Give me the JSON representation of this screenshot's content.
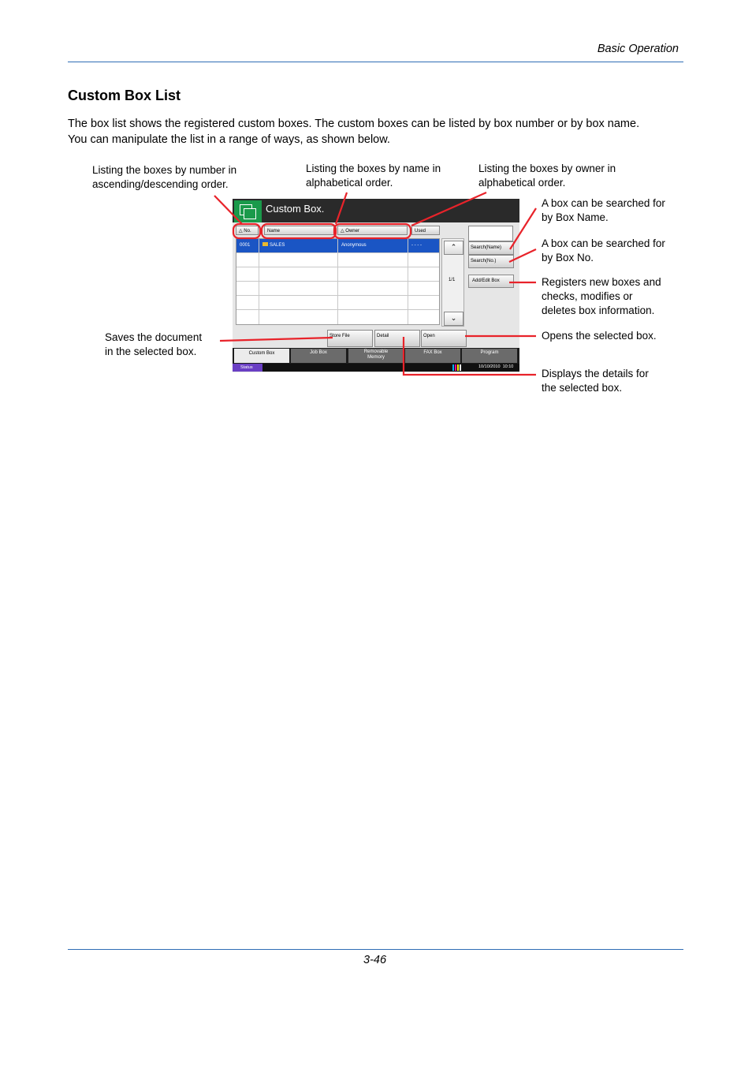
{
  "header": {
    "section_name": "Basic Operation",
    "page_number": "3-46"
  },
  "title": "Custom Box List",
  "intro": [
    "The box list shows the registered custom boxes. The custom boxes can be listed by box number or by box name.",
    "You can manipulate the list in a range of ways, as shown below."
  ],
  "callouts": {
    "sort_number": [
      "Listing the boxes by number in",
      "ascending/descending order."
    ],
    "sort_name": [
      "Listing the boxes by name in",
      "alphabetical order."
    ],
    "sort_owner": [
      "Listing the boxes by owner in",
      "alphabetical order."
    ],
    "search_name": [
      "A box can be searched for",
      "by Box Name."
    ],
    "search_no": [
      "A box can be searched for",
      "by Box No."
    ],
    "add_edit": [
      "Registers new boxes and",
      "checks, modifies or",
      "deletes box information."
    ],
    "store_file": [
      "Saves the document",
      "in the selected box."
    ],
    "open": [
      "Opens the selected box."
    ],
    "detail": [
      "Displays the details for",
      "the selected box."
    ]
  },
  "screen": {
    "title": "Custom Box.",
    "columns": {
      "no": "No.",
      "name": "Name",
      "owner": "Owner",
      "used": "Used"
    },
    "row": {
      "no": "0001",
      "name": "SALES",
      "owner": "Anonymous",
      "used": "- - - -"
    },
    "page_indicator": "1/1",
    "buttons": {
      "search_name": "Search(Name)",
      "search_no": "Search(No.)",
      "add_edit": "Add/Edit Box",
      "store_file": "Store File",
      "detail": "Detail",
      "open": "Open"
    },
    "tabs": {
      "custom_box": "Custom Box",
      "job_box": "Job Box",
      "removable_1": "Removable",
      "removable_2": "Memory",
      "fax_box": "FAX Box",
      "program": "Program"
    },
    "status": "Status",
    "datetime": "10/10/2010  10:10"
  },
  "colors": {
    "accent_rule": "#2f6db5",
    "callout_line": "#e8232a",
    "selection": "#1a55c4",
    "status_bar": "#6a3fc4"
  }
}
